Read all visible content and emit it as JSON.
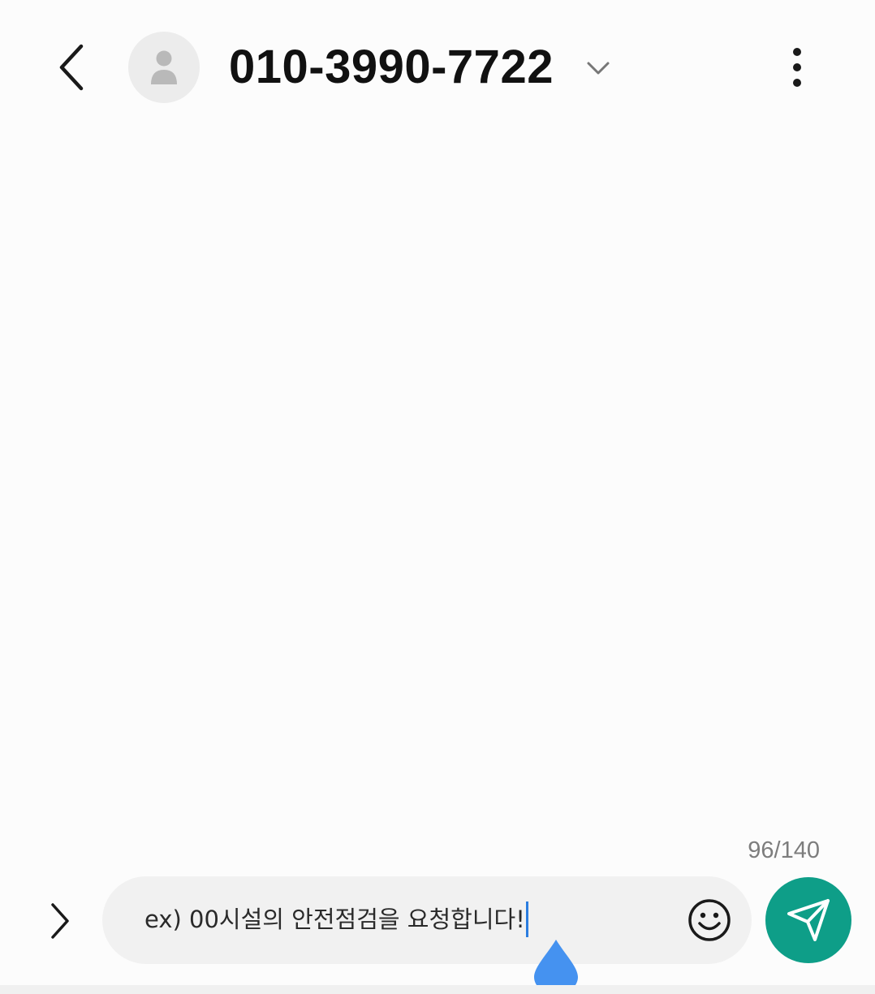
{
  "header": {
    "contact_number": "010-3990-7722",
    "back_icon": "chevron-left-icon",
    "avatar_icon": "person-icon",
    "expand_icon": "chevron-down-icon",
    "menu_icon": "more-vertical-icon"
  },
  "composer": {
    "char_count": "96/140",
    "message_value": "ex) 00시설의 안전점검을 요청합니다!",
    "expand_icon": "chevron-right-icon",
    "emoji_icon": "smiley-icon",
    "send_icon": "send-icon",
    "handle_icon": "text-cursor-handle-icon"
  },
  "colors": {
    "background": "#fcfcfc",
    "send_button": "#0e9e88",
    "cursor_handle": "#4592f0",
    "input_background": "#f1f1f1"
  }
}
